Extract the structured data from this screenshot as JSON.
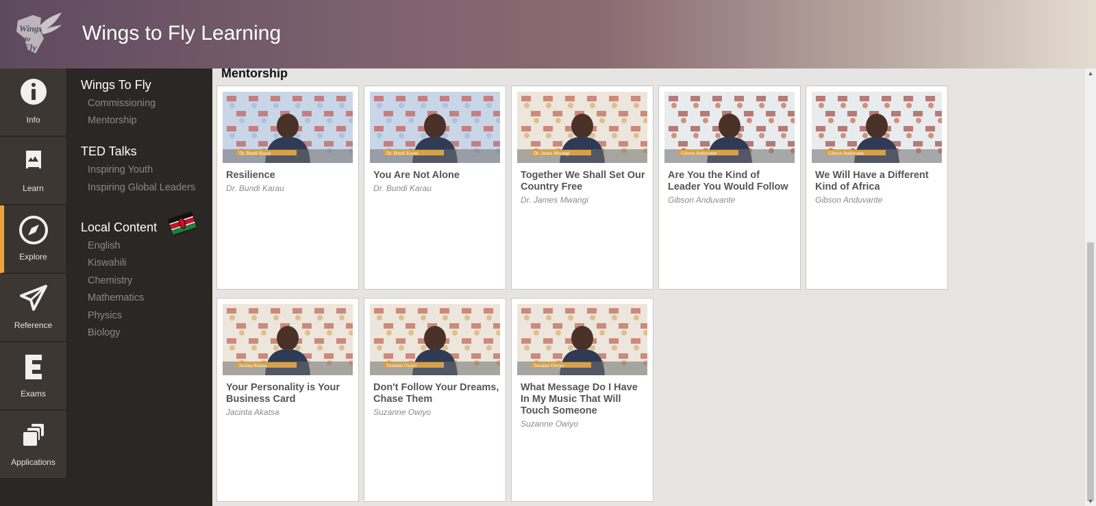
{
  "app": {
    "title": "Wings to Fly Learning",
    "logo_text": "Wings to Fly"
  },
  "rail": [
    {
      "label": "Info",
      "icon": "info-icon"
    },
    {
      "label": "Learn",
      "icon": "learn-icon"
    },
    {
      "label": "Explore",
      "icon": "compass-icon",
      "active": true
    },
    {
      "label": "Reference",
      "icon": "paper-plane-icon"
    },
    {
      "label": "Exams",
      "icon": "exams-icon"
    },
    {
      "label": "Applications",
      "icon": "applications-icon"
    }
  ],
  "menu": {
    "groups": [
      {
        "title": "Wings To Fly",
        "items": [
          "Commissioning",
          "Mentorship"
        ]
      },
      {
        "title": "TED Talks",
        "items": [
          "Inspiring Youth",
          "Inspiring Global Leaders"
        ]
      },
      {
        "title": "Local Content",
        "items": [
          "English",
          "Kiswahili",
          "Chemistry",
          "Mathematics",
          "Physics",
          "Biology"
        ],
        "flag": "kenya-flag-icon"
      }
    ]
  },
  "main": {
    "section_title": "Mentorship",
    "cards": [
      {
        "title": "Resilience",
        "author": "Dr. Bundi Karau",
        "thumb_caption": "Dr. Bundi Karau",
        "backdrop": "blue"
      },
      {
        "title": "You Are Not Alone",
        "author": "Dr. Bundi Karau",
        "thumb_caption": "Dr. Bundi Karau",
        "backdrop": "blue"
      },
      {
        "title": "Together We Shall Set Our Country Free",
        "author": "Dr. James Mwangi",
        "thumb_caption": "Dr. James Mwangi",
        "backdrop": "warm"
      },
      {
        "title": "Are You the Kind of Leader You Would Follow",
        "author": "Gibson Anduvante",
        "thumb_caption": "Gibson Anduvante",
        "backdrop": "equity"
      },
      {
        "title": "We Will Have a Different Kind of Africa",
        "author": "Gibson Anduvante",
        "thumb_caption": "Gibson Anduvante",
        "backdrop": "equity"
      },
      {
        "title": "Your Personality is Your Business Card",
        "author": "Jacinta Akatsa",
        "thumb_caption": "Jacinta Akatsa",
        "backdrop": "warm"
      },
      {
        "title": "Don't Follow Your Dreams, Chase Them",
        "author": "Suzanne Owiyo",
        "thumb_caption": "Suzanne Owiyo",
        "backdrop": "warm"
      },
      {
        "title": "What Message Do I Have In My Music That Will Touch Someone",
        "author": "Suzanne Owiyo",
        "thumb_caption": "Suzanne Owiyo",
        "backdrop": "warm"
      }
    ]
  },
  "colors": {
    "accent": "#f0a23a",
    "rail_bg": "#3d3733",
    "sidebar_bg": "#2b2724",
    "content_bg": "#e6e5e3"
  }
}
